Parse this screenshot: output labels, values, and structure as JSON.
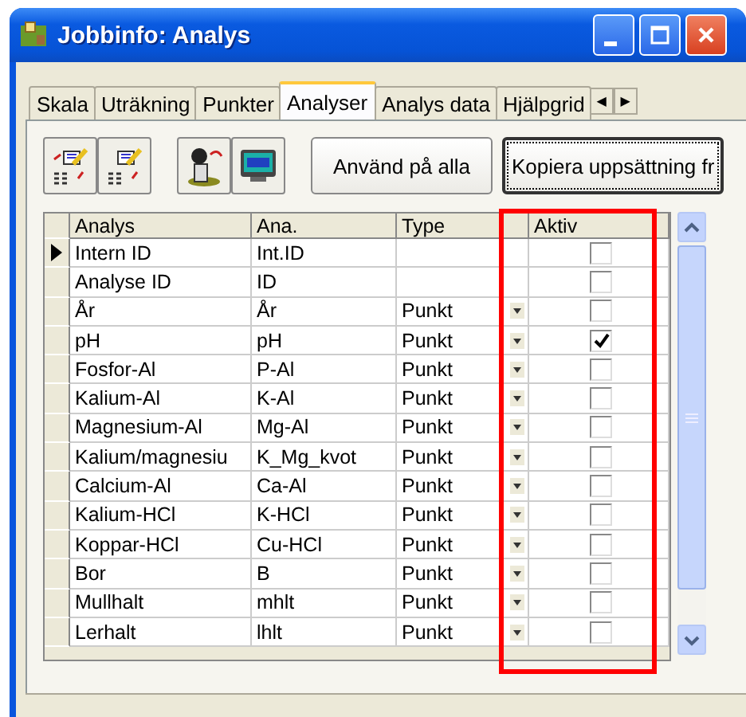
{
  "window": {
    "title": "Jobbinfo: Analys"
  },
  "tabs": [
    {
      "label": "Skala",
      "selected": false
    },
    {
      "label": "Uträkning",
      "selected": false
    },
    {
      "label": "Punkter",
      "selected": false
    },
    {
      "label": "Analyser",
      "selected": true
    },
    {
      "label": "Analys data",
      "selected": false
    },
    {
      "label": "Hjälpgrid",
      "selected": false
    }
  ],
  "tab_scroll": [
    "◀",
    "▶"
  ],
  "toolbar_buttons": [
    {
      "label": "Använd på alla",
      "focused": false
    },
    {
      "label": "Kopiera uppsättning fr",
      "focused": true
    }
  ],
  "grid": {
    "columns": [
      "Analys",
      "Ana.",
      "Type",
      "Aktiv"
    ],
    "rows": [
      {
        "analys": "Intern ID",
        "ana": "Int.ID",
        "aktiv": false,
        "current": true
      },
      {
        "analys": "Analyse ID",
        "ana": "ID",
        "aktiv": false,
        "current": false
      },
      {
        "analys": "År",
        "ana": "År",
        "type": "Punkt",
        "aktiv": false,
        "current": false
      },
      {
        "analys": "pH",
        "ana": "pH",
        "type": "Punkt",
        "aktiv": true,
        "current": false
      },
      {
        "analys": "Fosfor-Al",
        "ana": "P-Al",
        "type": "Punkt",
        "aktiv": false,
        "current": false
      },
      {
        "analys": "Kalium-Al",
        "ana": "K-Al",
        "type": "Punkt",
        "aktiv": false,
        "current": false
      },
      {
        "analys": "Magnesium-Al",
        "ana": "Mg-Al",
        "type": "Punkt",
        "aktiv": false,
        "current": false
      },
      {
        "analys": "Kalium/magnesiu",
        "ana": "K_Mg_kvot",
        "type": "Punkt",
        "aktiv": false,
        "current": false
      },
      {
        "analys": "Calcium-Al",
        "ana": "Ca-Al",
        "type": "Punkt",
        "aktiv": false,
        "current": false
      },
      {
        "analys": "Kalium-HCl",
        "ana": "K-HCl",
        "type": "Punkt",
        "aktiv": false,
        "current": false
      },
      {
        "analys": "Koppar-HCl",
        "ana": "Cu-HCl",
        "type": "Punkt",
        "aktiv": false,
        "current": false
      },
      {
        "analys": "Bor",
        "ana": "B",
        "type": "Punkt",
        "aktiv": false,
        "current": false
      },
      {
        "analys": "Mullhalt",
        "ana": "mhlt",
        "type": "Punkt",
        "aktiv": false,
        "current": false
      },
      {
        "analys": "Lerhalt",
        "ana": "lhlt",
        "type": "Punkt",
        "aktiv": false,
        "current": false
      }
    ]
  }
}
